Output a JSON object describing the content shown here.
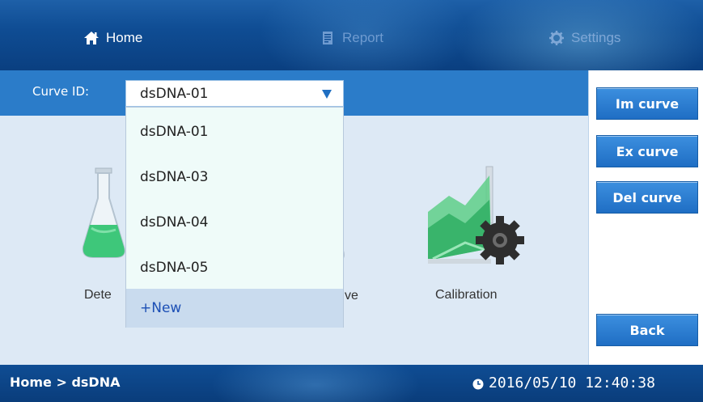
{
  "nav": {
    "tabs": [
      {
        "label": "Home",
        "icon": "home-icon",
        "active": true
      },
      {
        "label": "Report",
        "icon": "report-icon",
        "active": false
      },
      {
        "label": "Settings",
        "icon": "gear-icon",
        "active": false
      }
    ]
  },
  "curve": {
    "label": "Curve ID:",
    "selected": "dsDNA-01",
    "options": [
      "dsDNA-01",
      "dsDNA-03",
      "dsDNA-04",
      "dsDNA-05"
    ],
    "new_label": "+New"
  },
  "features": [
    {
      "label": "Dete",
      "icon": "flask-icon"
    },
    {
      "label": "ve",
      "icon": "flask-icon"
    },
    {
      "label": "Calibration",
      "icon": "calibration-chart-gear-icon"
    }
  ],
  "sidebar": {
    "buttons": [
      "Im curve",
      "Ex curve",
      "Del curve"
    ],
    "back": "Back"
  },
  "status": {
    "breadcrumb": "Home > dsDNA",
    "datetime": "2016/05/10 12:40:38"
  },
  "colors": {
    "header_blue": "#0f4d94",
    "curve_bar": "#2b7cc9",
    "button_blue": "#1f6ec4",
    "main_bg": "#dde9f5",
    "dropdown_bg": "#effbf9",
    "new_option_bg": "#c9dbee"
  }
}
